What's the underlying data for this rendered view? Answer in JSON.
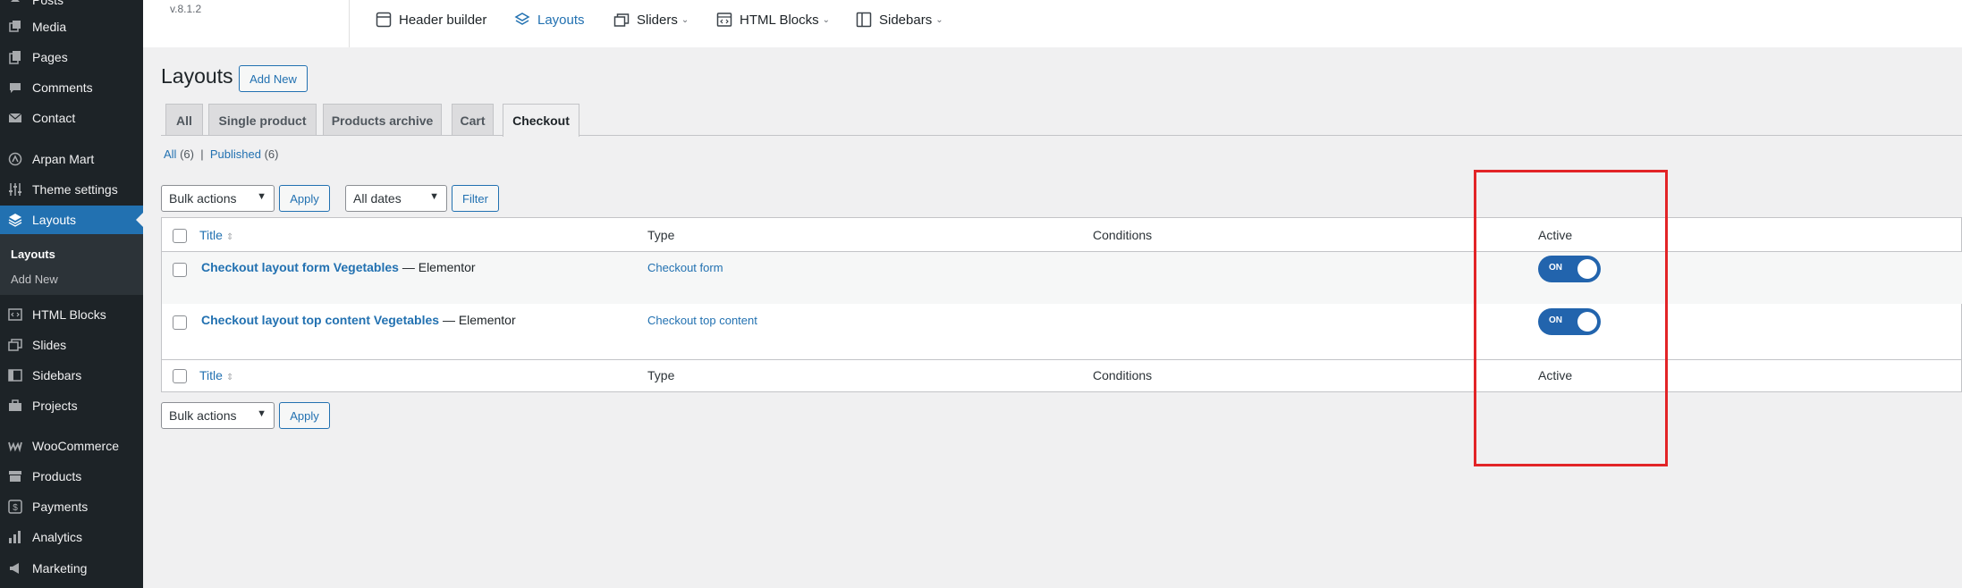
{
  "sidebar": {
    "items": [
      {
        "label": "Posts",
        "icon": "pin-icon"
      },
      {
        "label": "Media",
        "icon": "media-icon"
      },
      {
        "label": "Pages",
        "icon": "pages-icon"
      },
      {
        "label": "Comments",
        "icon": "comment-icon"
      },
      {
        "label": "Contact",
        "icon": "mail-icon"
      },
      {
        "label": "Arpan Mart",
        "icon": "theme-logo-icon"
      },
      {
        "label": "Theme settings",
        "icon": "settings-sliders-icon"
      },
      {
        "label": "Layouts",
        "icon": "layers-icon"
      },
      {
        "label": "HTML Blocks",
        "icon": "html-block-icon"
      },
      {
        "label": "Slides",
        "icon": "slides-icon"
      },
      {
        "label": "Sidebars",
        "icon": "sidebar-icon"
      },
      {
        "label": "Projects",
        "icon": "portfolio-icon"
      },
      {
        "label": "WooCommerce",
        "icon": "woocommerce-icon"
      },
      {
        "label": "Products",
        "icon": "archive-icon"
      },
      {
        "label": "Payments",
        "icon": "dollar-icon"
      },
      {
        "label": "Analytics",
        "icon": "bar-chart-icon"
      },
      {
        "label": "Marketing",
        "icon": "megaphone-icon"
      }
    ],
    "submenu": [
      "Layouts",
      "Add New"
    ]
  },
  "topbar": {
    "version": "v.8.1.2",
    "nav": [
      {
        "label": "Header builder"
      },
      {
        "label": "Layouts"
      },
      {
        "label": "Sliders"
      },
      {
        "label": "HTML Blocks"
      },
      {
        "label": "Sidebars"
      }
    ]
  },
  "main": {
    "title": "Layouts",
    "add_new": "Add New",
    "tabs": [
      "All",
      "Single product",
      "Products archive",
      "Cart",
      "Checkout"
    ],
    "filters": {
      "all_label": "All",
      "all_count": "(6)",
      "separator": "|",
      "published_label": "Published",
      "published_count": "(6)"
    },
    "bulk_actions": "Bulk actions",
    "apply": "Apply",
    "dates": "All dates",
    "filter": "Filter"
  },
  "table": {
    "columns": [
      "Title",
      "Type",
      "Conditions",
      "Active"
    ],
    "rows": [
      {
        "title": "Checkout layout form Vegetables",
        "suffix": "— Elementor",
        "type": "Checkout form",
        "active": "ON"
      },
      {
        "title": "Checkout layout top content Vegetables",
        "suffix": "— Elementor",
        "type": "Checkout top content",
        "active": "ON"
      }
    ]
  },
  "colors": {
    "accent": "#2271b1",
    "sidebar": "#1d2327",
    "toggle": "#2264ad",
    "highlight": "#e22427"
  }
}
